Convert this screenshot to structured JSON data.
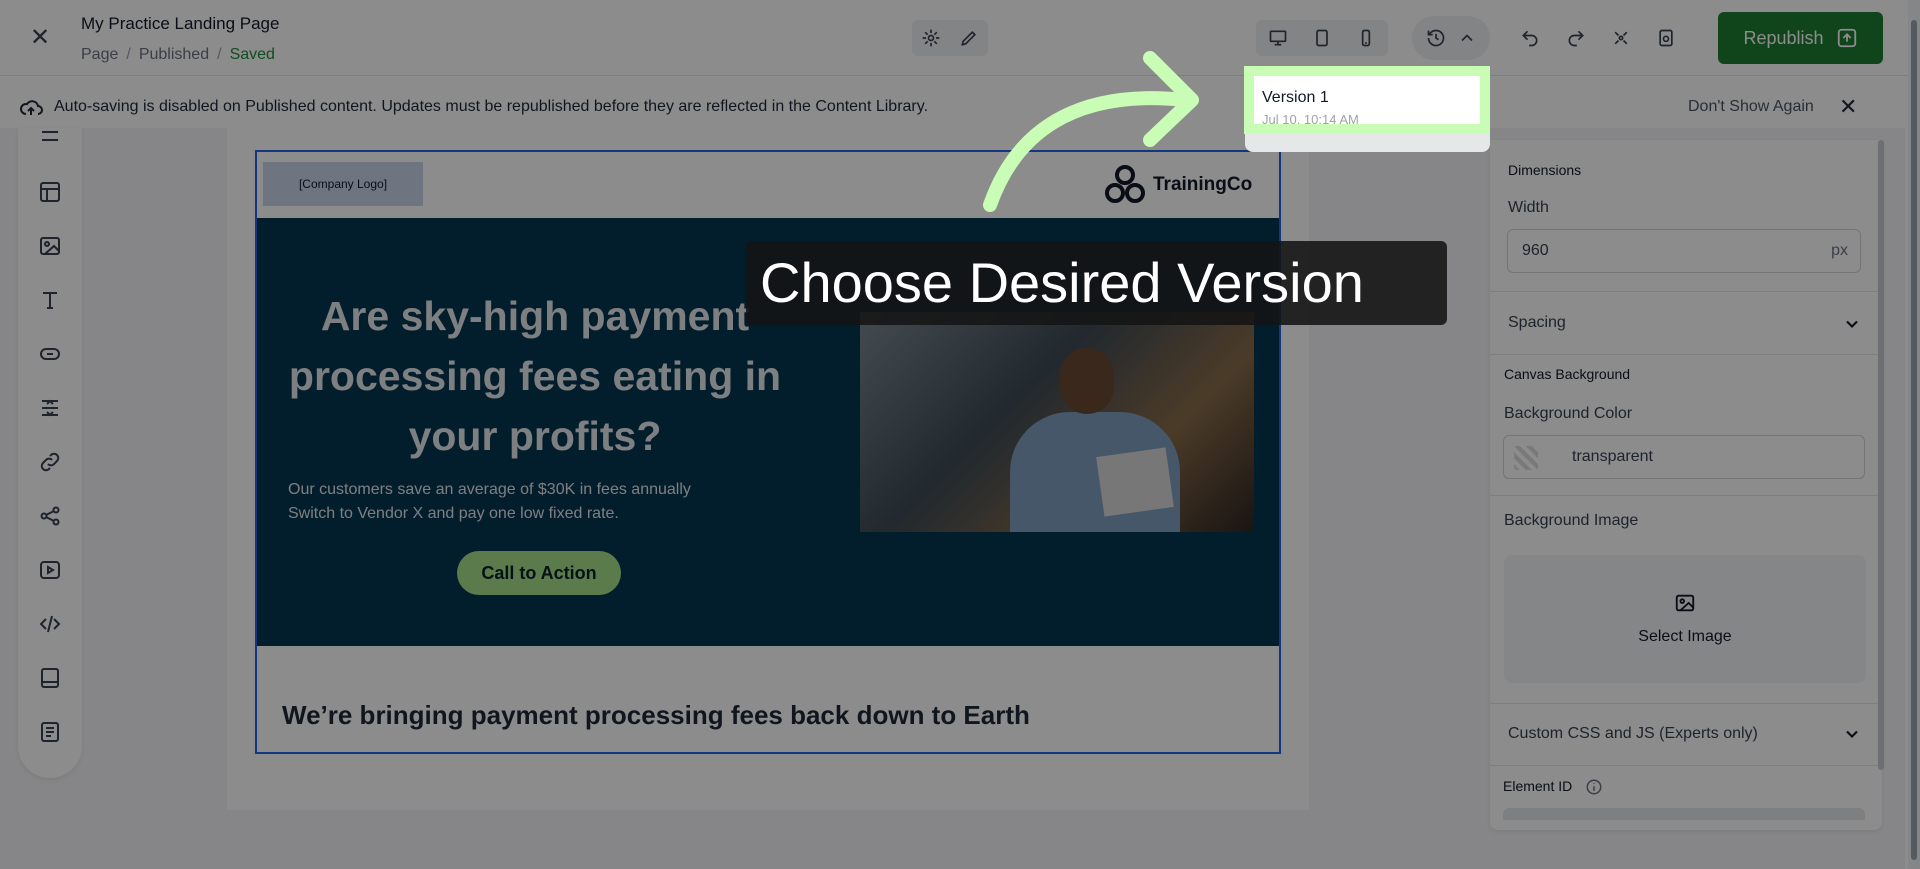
{
  "header": {
    "title": "My Practice Landing Page",
    "breadcrumb": [
      "Page",
      "Published",
      "Saved"
    ],
    "republish_label": "Republish"
  },
  "notice": {
    "message": "Auto-saving is disabled on Published content. Updates must be republished before they are reflected in the Content Library.",
    "dont_show": "Don't Show Again"
  },
  "canvas": {
    "logo_placeholder": "[Company Logo]",
    "brand_name": "TrainingCo",
    "hero_heading": "Are sky-high payment processing fees eating in your profits?",
    "hero_line1": "Our customers save an average of $30K in fees annually",
    "hero_line2": "Switch to Vendor X and pay one low fixed rate.",
    "cta": "Call to Action",
    "subheading": "We’re bringing payment processing fees back down to Earth"
  },
  "panel": {
    "dimensions": "Dimensions",
    "width_label": "Width",
    "width_value": "960",
    "width_unit": "px",
    "spacing": "Spacing",
    "canvas_background": "Canvas Background",
    "bg_color_label": "Background Color",
    "bg_color_value": "transparent",
    "bg_image_label": "Background Image",
    "select_image": "Select Image",
    "custom_css": "Custom CSS and JS  (Experts only)",
    "element_id": "Element ID"
  },
  "versions": {
    "item_name": "Version 1",
    "item_date": "Jul 10, 10:14 AM"
  },
  "callout": {
    "text": "Choose Desired Version"
  },
  "colors": {
    "highlight": "#c9fdb6",
    "republish": "#1e7e34",
    "hero_bg": "#04364f",
    "cta": "#a6e08d"
  }
}
